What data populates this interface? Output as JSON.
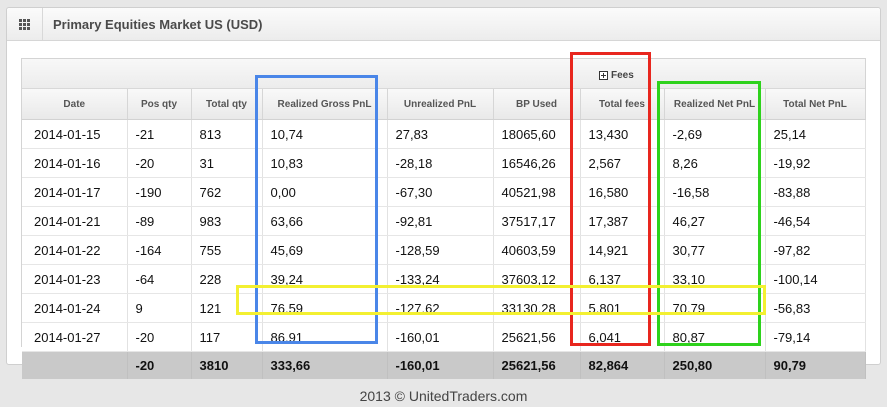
{
  "panel": {
    "title": "Primary Equities Market US (USD)"
  },
  "table": {
    "group_header": "Fees",
    "columns": [
      "Date",
      "Pos qty",
      "Total qty",
      "Realized Gross PnL",
      "Unrealized PnL",
      "BP Used",
      "Total fees",
      "Realized Net PnL",
      "Total Net PnL"
    ],
    "rows": [
      [
        "2014-01-15",
        "-21",
        "813",
        "10,74",
        "27,83",
        "18065,60",
        "13,430",
        "-2,69",
        "25,14"
      ],
      [
        "2014-01-16",
        "-20",
        "31",
        "10,83",
        "-28,18",
        "16546,26",
        "2,567",
        "8,26",
        "-19,92"
      ],
      [
        "2014-01-17",
        "-190",
        "762",
        "0,00",
        "-67,30",
        "40521,98",
        "16,580",
        "-16,58",
        "-83,88"
      ],
      [
        "2014-01-21",
        "-89",
        "983",
        "63,66",
        "-92,81",
        "37517,17",
        "17,387",
        "46,27",
        "-46,54"
      ],
      [
        "2014-01-22",
        "-164",
        "755",
        "45,69",
        "-128,59",
        "40603,59",
        "14,921",
        "30,77",
        "-97,82"
      ],
      [
        "2014-01-23",
        "-64",
        "228",
        "39,24",
        "-133,24",
        "37603,12",
        "6,137",
        "33,10",
        "-100,14"
      ],
      [
        "2014-01-24",
        "9",
        "121",
        "76,59",
        "-127,62",
        "33130,28",
        "5,801",
        "70,79",
        "-56,83"
      ],
      [
        "2014-01-27",
        "-20",
        "117",
        "86,91",
        "-160,01",
        "25621,56",
        "6,041",
        "80,87",
        "-79,14"
      ]
    ],
    "totals": [
      "",
      "-20",
      "3810",
      "333,66",
      "-160,01",
      "25621,56",
      "82,864",
      "250,80",
      "90,79"
    ]
  },
  "highlights": {
    "blue": "#4a86e8",
    "red": "#e8261e",
    "green": "#2ed21c",
    "yellow": "#f3f031"
  },
  "footer": {
    "text": "2013 © UnitedTraders.com"
  },
  "icons": {
    "panel_icon": "grid-icon",
    "fees_toggle_icon": "expand-plus-icon"
  }
}
